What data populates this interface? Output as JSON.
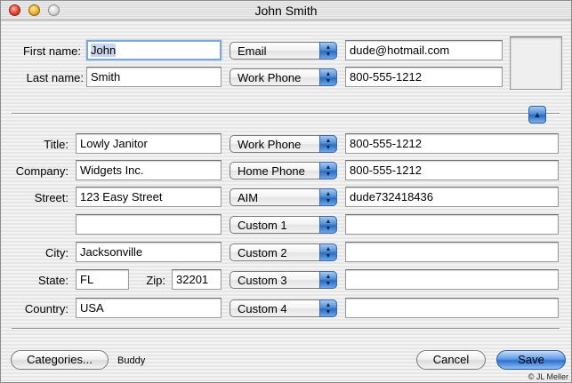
{
  "window": {
    "title": "John Smith"
  },
  "name": {
    "first_label": "First name:",
    "first_value": "John",
    "last_label": "Last name:",
    "last_value": "Smith"
  },
  "top_contacts": [
    {
      "type": "Email",
      "value": "dude@hotmail.com"
    },
    {
      "type": "Work Phone",
      "value": "800-555-1212"
    }
  ],
  "details": {
    "title_label": "Title:",
    "title_value": "Lowly Janitor",
    "company_label": "Company:",
    "company_value": "Widgets Inc.",
    "street_label": "Street:",
    "street_value": "123 Easy Street",
    "street2_value": "",
    "city_label": "City:",
    "city_value": "Jacksonville",
    "state_label": "State:",
    "state_value": "FL",
    "zip_label": "Zip:",
    "zip_value": "32201",
    "country_label": "Country:",
    "country_value": "USA"
  },
  "contacts": [
    {
      "type": "Work Phone",
      "value": "800-555-1212"
    },
    {
      "type": "Home Phone",
      "value": "800-555-1212"
    },
    {
      "type": "AIM",
      "value": "dude732418436"
    },
    {
      "type": "Custom 1",
      "value": ""
    },
    {
      "type": "Custom 2",
      "value": ""
    },
    {
      "type": "Custom 3",
      "value": ""
    },
    {
      "type": "Custom 4",
      "value": ""
    }
  ],
  "footer": {
    "categories_label": "Categories...",
    "category_value": "Buddy",
    "cancel_label": "Cancel",
    "save_label": "Save"
  },
  "copyright": "© JL Meller",
  "icons": {
    "popup_arrows": "updown-arrows-icon",
    "collapse": "triangle-up-icon"
  },
  "colors": {
    "accent": "#3f7fd6",
    "focus_ring": "#7da7d9"
  }
}
